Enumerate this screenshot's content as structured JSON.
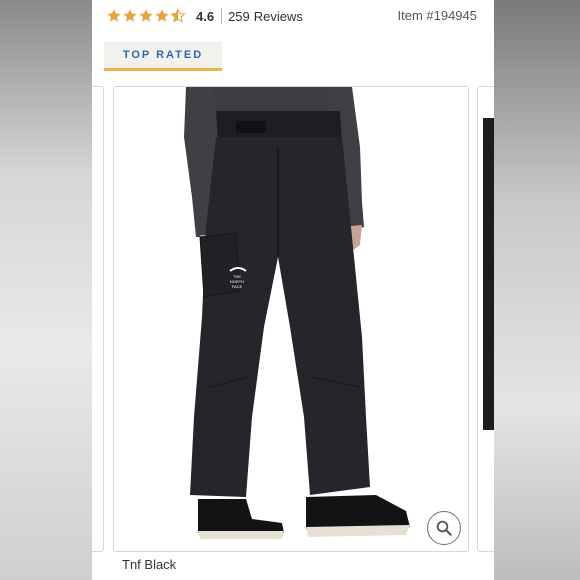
{
  "rating": {
    "stars": 4.5,
    "value": "4.6",
    "review_count": "259",
    "review_label": "Reviews"
  },
  "item_number": "Item #194945",
  "badge": "TOP RATED",
  "product": {
    "logo_lines": [
      "THE",
      "NORTH",
      "FACE"
    ],
    "color_name": "Tnf Black"
  },
  "icons": {
    "star": "star-icon",
    "zoom": "magnifier-icon"
  },
  "colors": {
    "star": "#e8a33a",
    "badge_text": "#2a6ab3",
    "badge_underline": "#e8b54d",
    "badge_bg": "#f3f1ec"
  }
}
